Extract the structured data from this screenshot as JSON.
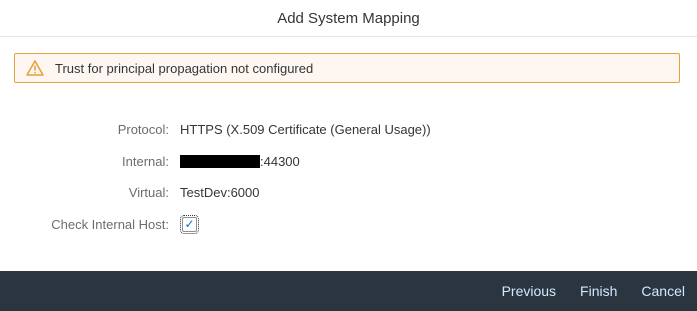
{
  "dialog": {
    "title": "Add System Mapping"
  },
  "warning": {
    "icon": "warning-triangle-icon",
    "message": "Trust for principal propagation not configured",
    "accent_color": "#e9a23b",
    "background_color": "#fef7f1"
  },
  "form": {
    "protocol": {
      "label": "Protocol:",
      "value": "HTTPS (X.509 Certificate (General Usage))"
    },
    "internal": {
      "label": "Internal:",
      "value_suffix": ":44300"
    },
    "virtual": {
      "label": "Virtual:",
      "value": "TestDev:6000"
    },
    "check_internal_host": {
      "label": "Check Internal Host:",
      "checked": true,
      "check_glyph": "✓"
    }
  },
  "footer": {
    "background_color": "#2b3540",
    "buttons": {
      "previous": "Previous",
      "finish": "Finish",
      "cancel": "Cancel"
    }
  }
}
